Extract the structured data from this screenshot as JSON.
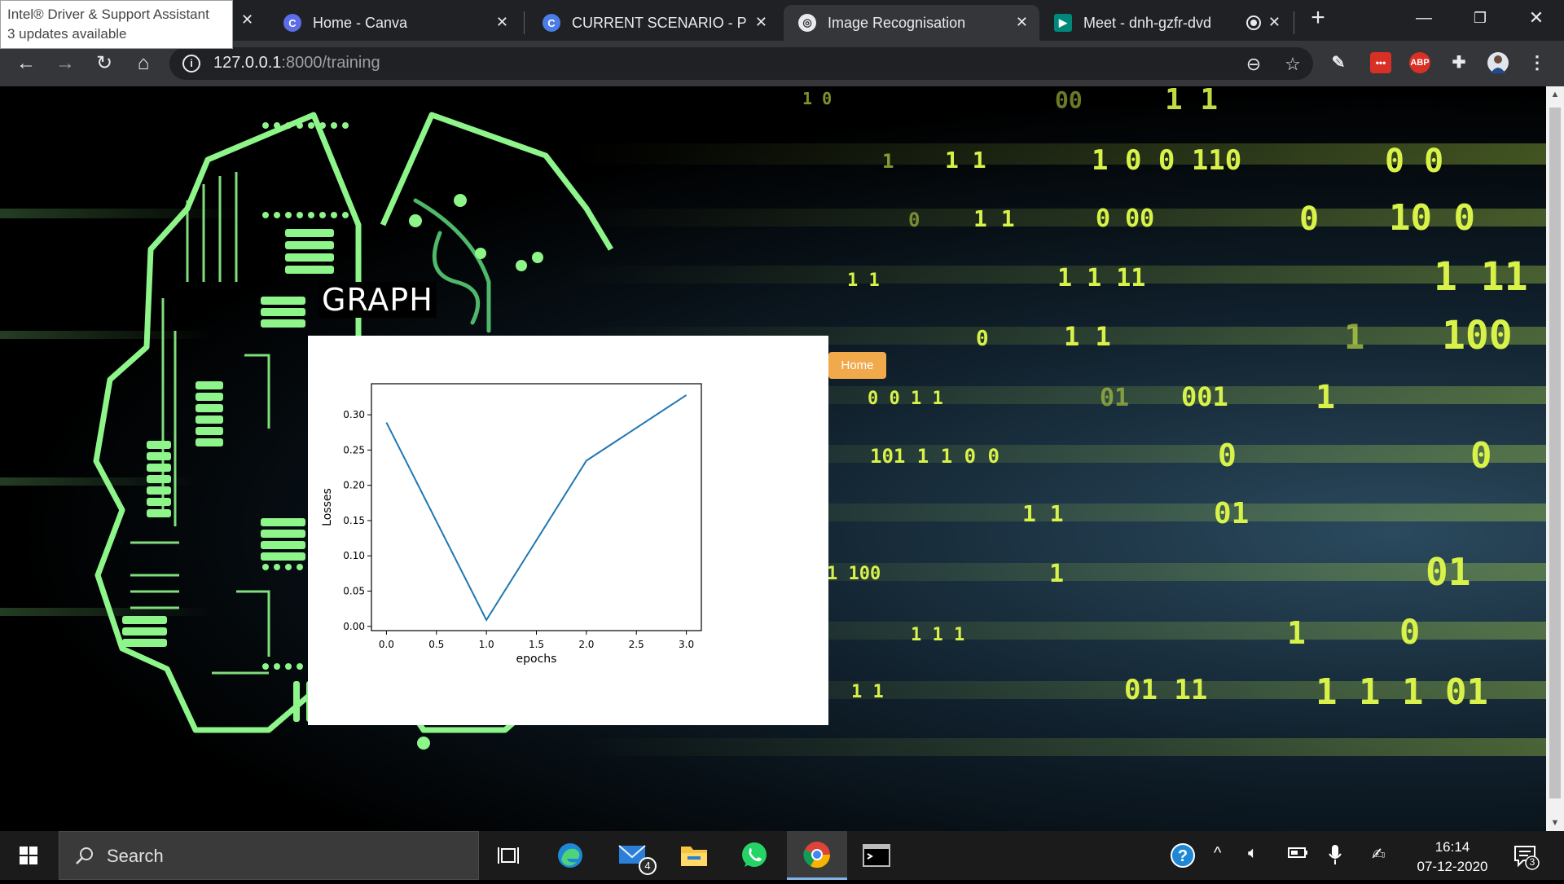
{
  "notification": {
    "line1": "Intel® Driver & Support Assistant",
    "line2": "3 updates available"
  },
  "tabs": [
    {
      "label": "Home - Canva",
      "icon": "canva-icon"
    },
    {
      "label": "CURRENT SCENARIO - Pres",
      "icon": "canva-icon"
    },
    {
      "label": "Image Recognisation",
      "icon": "globe-icon",
      "active": true
    },
    {
      "label": "Meet - dnh-gzfr-dvd",
      "icon": "meet-icon"
    }
  ],
  "address": {
    "host": "127.0.0.1",
    "rest": ":8000/training"
  },
  "extensions": {
    "abp": "ABP"
  },
  "page": {
    "title": "GRAPH",
    "home_button": "Home"
  },
  "chart_data": {
    "type": "line",
    "title": "",
    "xlabel": "epochs",
    "ylabel": "Losses",
    "x": [
      0.0,
      1.0,
      2.0,
      3.0
    ],
    "series": [
      {
        "values": [
          0.289,
          0.009,
          0.235,
          0.328
        ],
        "color": "#1f77b4"
      }
    ],
    "xlim": [
      -0.15,
      3.15
    ],
    "ylim": [
      -0.006,
      0.344
    ],
    "xticks": [
      0.0,
      0.5,
      1.0,
      1.5,
      2.0,
      2.5,
      3.0
    ],
    "xtick_labels": [
      "0.0",
      "0.5",
      "1.0",
      "1.5",
      "2.0",
      "2.5",
      "3.0"
    ],
    "yticks": [
      0.0,
      0.05,
      0.1,
      0.15,
      0.2,
      0.25,
      0.3
    ],
    "ytick_labels": [
      "0.00",
      "0.05",
      "0.10",
      "0.15",
      "0.20",
      "0.25",
      "0.30"
    ],
    "grid": false,
    "legend": "none"
  },
  "taskbar": {
    "search_label": "Search",
    "mail_badge": "4",
    "time": "16:14",
    "date": "07-12-2020",
    "notif_count": "3"
  },
  "colors": {
    "accent": "#f0a94b",
    "binary_digits": "#d8f24a",
    "circuit": "#8ef58a"
  }
}
